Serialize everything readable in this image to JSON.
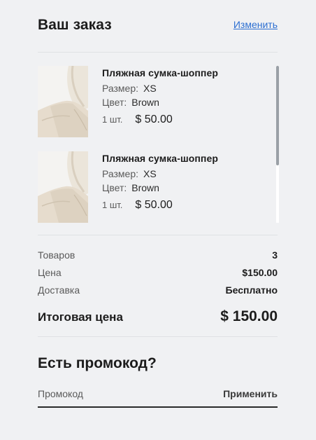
{
  "header": {
    "title": "Ваш заказ",
    "edit_label": "Изменить"
  },
  "items": [
    {
      "name": "Пляжная сумка-шоппер",
      "size_label": "Размер:",
      "size_value": "XS",
      "color_label": "Цвет:",
      "color_value": "Brown",
      "qty": "1 шт.",
      "price": "$ 50.00",
      "image_icon": "tote-bag-image"
    },
    {
      "name": "Пляжная сумка-шоппер",
      "size_label": "Размер:",
      "size_value": "XS",
      "color_label": "Цвет:",
      "color_value": "Brown",
      "qty": "1 шт.",
      "price": "$ 50.00",
      "image_icon": "tote-bag-image"
    }
  ],
  "summary": {
    "items_label": "Товаров",
    "items_value": "3",
    "price_label": "Цена",
    "price_value": "$150.00",
    "delivery_label": "Доставка",
    "delivery_value": "Бесплатно",
    "total_label": "Итоговая цена",
    "total_value": "$ 150.00"
  },
  "promo": {
    "title": "Есть промокод?",
    "placeholder": "Промокод",
    "apply_label": "Применить"
  },
  "colors": {
    "background": "#f0f1f3",
    "link": "#2d6fd1",
    "text": "#1c1c1c",
    "muted": "#5a5a5a",
    "bag": "#e6dccd"
  }
}
